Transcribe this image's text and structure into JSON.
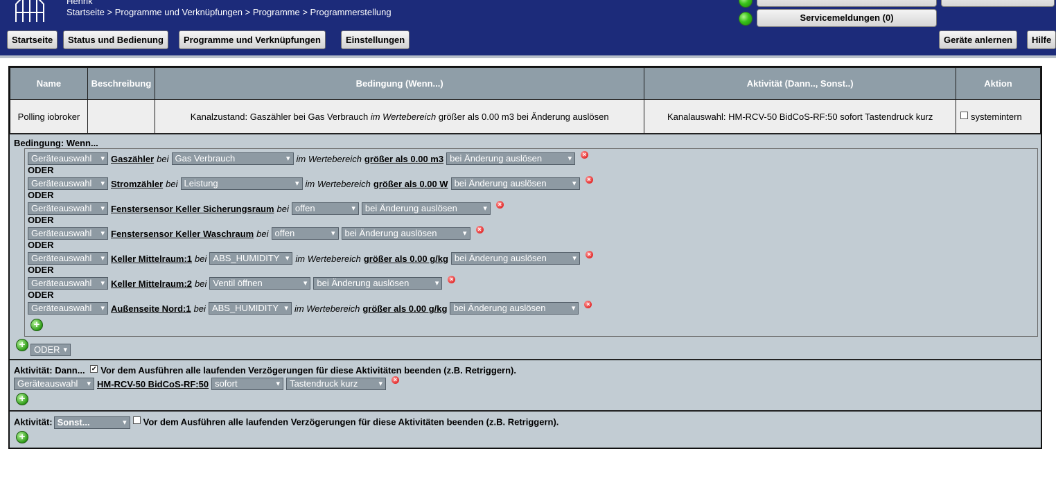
{
  "header": {
    "user_name": "Henrik",
    "breadcrumb": "Startseite > Programme und Verknüpfungen > Programme > Programmerstellung",
    "service_button": "Servicemeldungen (0)"
  },
  "nav": {
    "items": [
      "Startseite",
      "Status und Bedienung",
      "Programme und Verknüpfungen",
      "Einstellungen"
    ],
    "right_items": [
      "Geräte anlernen",
      "Hilfe"
    ]
  },
  "table": {
    "headers": [
      "Name",
      "Beschreibung",
      "Bedingung (Wenn...)",
      "Aktivität (Dann.., Sonst..)",
      "Aktion"
    ],
    "row": {
      "name": "Polling iobroker",
      "description": "",
      "condition_pre": "Kanalzustand: Gaszähler bei Gas Verbrauch ",
      "condition_italic": "im Wertebereich",
      "condition_post": " größer als 0.00 m3 bei Änderung auslösen",
      "activity": "Kanalauswahl: HM-RCV-50 BidCoS-RF:50 sofort Tastendruck kurz",
      "action_checkbox_label": "systemintern"
    }
  },
  "condition": {
    "title": "Bedingung: Wenn...",
    "connector": "ODER",
    "rows": [
      {
        "select": "Geräteauswahl",
        "device": "Gaszähler",
        "bei": "bei",
        "param": "Gas Verbrauch",
        "range": "im Wertebereich",
        "compare": "größer als 0.00 m3",
        "trigger": "bei Änderung auslösen"
      },
      {
        "select": "Geräteauswahl",
        "device": "Stromzähler",
        "bei": "bei",
        "param": "Leistung",
        "range": "im Wertebereich",
        "compare": "größer als 0.00 W",
        "trigger": "bei Änderung auslösen"
      },
      {
        "select": "Geräteauswahl",
        "device": "Fenstersensor Keller Sicherungsraum",
        "bei": "bei",
        "param": "offen",
        "trigger": "bei Änderung auslösen"
      },
      {
        "select": "Geräteauswahl",
        "device": "Fenstersensor Keller Waschraum",
        "bei": "bei",
        "param": "offen",
        "trigger": "bei Änderung auslösen"
      },
      {
        "select": "Geräteauswahl",
        "device": "Keller Mittelraum:1",
        "bei": "bei",
        "param": "ABS_HUMIDITY",
        "range": "im Wertebereich",
        "compare": "größer als 0.00 g/kg",
        "trigger": "bei Änderung auslösen"
      },
      {
        "select": "Geräteauswahl",
        "device": "Keller Mittelraum:2",
        "bei": "bei",
        "param": "Ventil öffnen",
        "trigger": "bei Änderung auslösen"
      },
      {
        "select": "Geräteauswahl",
        "device": "Außenseite Nord:1",
        "bei": "bei",
        "param": "ABS_HUMIDITY",
        "range": "im Wertebereich",
        "compare": "größer als 0.00 g/kg",
        "trigger": "bei Änderung auslösen"
      }
    ],
    "group_operator": "ODER"
  },
  "activity_then": {
    "title": "Aktivität: Dann...",
    "checkbox_checked": true,
    "checkbox_label": "Vor dem Ausführen alle laufenden Verzögerungen für diese Aktivitäten beenden (z.B. Retriggern).",
    "select": "Geräteauswahl",
    "device": "HM-RCV-50 BidCoS-RF:50",
    "timing": "sofort",
    "action": "Tastendruck kurz"
  },
  "activity_else": {
    "title": "Aktivität:",
    "select": "Sonst...",
    "checkbox_checked": false,
    "checkbox_label": "Vor dem Ausführen alle laufenden Verzögerungen für diese Aktivitäten beenden (z.B. Retriggern)."
  },
  "colors": {
    "header_bg": "#1c2b7a",
    "panel_bg": "#c2ccd3",
    "table_header_bg": "#8f9ea8",
    "select_bg": "#8e9aa3",
    "led_green": "#38c21a"
  }
}
